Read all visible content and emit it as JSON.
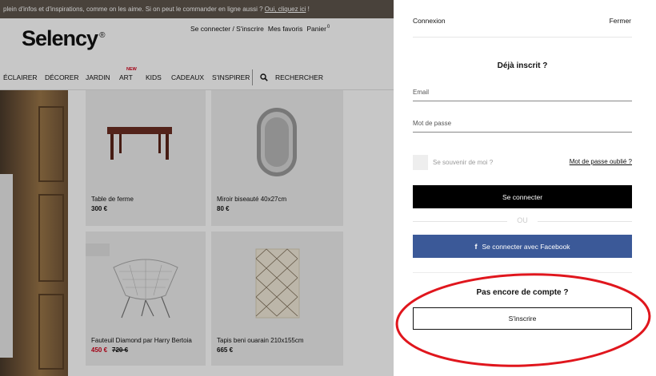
{
  "promo": {
    "text": "plein d'infos et d'inspirations, comme on les aime. Si on peut le commander en ligne aussi ? ",
    "link": "Oui, cliquez ici",
    "suffix": " !"
  },
  "header": {
    "logo": "Selency",
    "logo_mark": "®",
    "login_link": "Se connecter / S'inscrire",
    "favorites": "Mes favoris",
    "cart": "Panier",
    "cart_count": "0"
  },
  "nav": {
    "items": [
      "ÉCLAIRER",
      "DÉCORER",
      "JARDIN",
      "ART",
      "KIDS",
      "CADEAUX",
      "S'INSPIRER"
    ],
    "new_badge": "NEW",
    "search": "RECHERCHER"
  },
  "products": [
    {
      "name": "Table de ferme",
      "price": "300 €"
    },
    {
      "name": "Miroir biseauté 40x27cm",
      "price": "80 €"
    },
    {
      "name": "Fauteuil Diamond par Harry Bertoia",
      "price": "450 €",
      "old_price": "720 €"
    },
    {
      "name": "Tapis beni ouarain 210x155cm",
      "price": "665 €"
    }
  ],
  "panel": {
    "title": "Connexion",
    "close": "Fermer",
    "heading": "Déjà inscrit ?",
    "email_placeholder": "Email",
    "password_placeholder": "Mot de passe",
    "remember": "Se souvenir de moi ?",
    "forgot": "Mot de passe oublié ?",
    "login_button": "Se connecter",
    "or": "OU",
    "facebook_icon": "f",
    "facebook_button": "Se connecter avec Facebook",
    "no_account": "Pas encore de compte ?",
    "signup_button": "S'inscrire"
  },
  "colors": {
    "promo_bg": "#5e554c",
    "facebook": "#3b5998",
    "sale": "#d0021b",
    "annotation": "#e0161d"
  }
}
